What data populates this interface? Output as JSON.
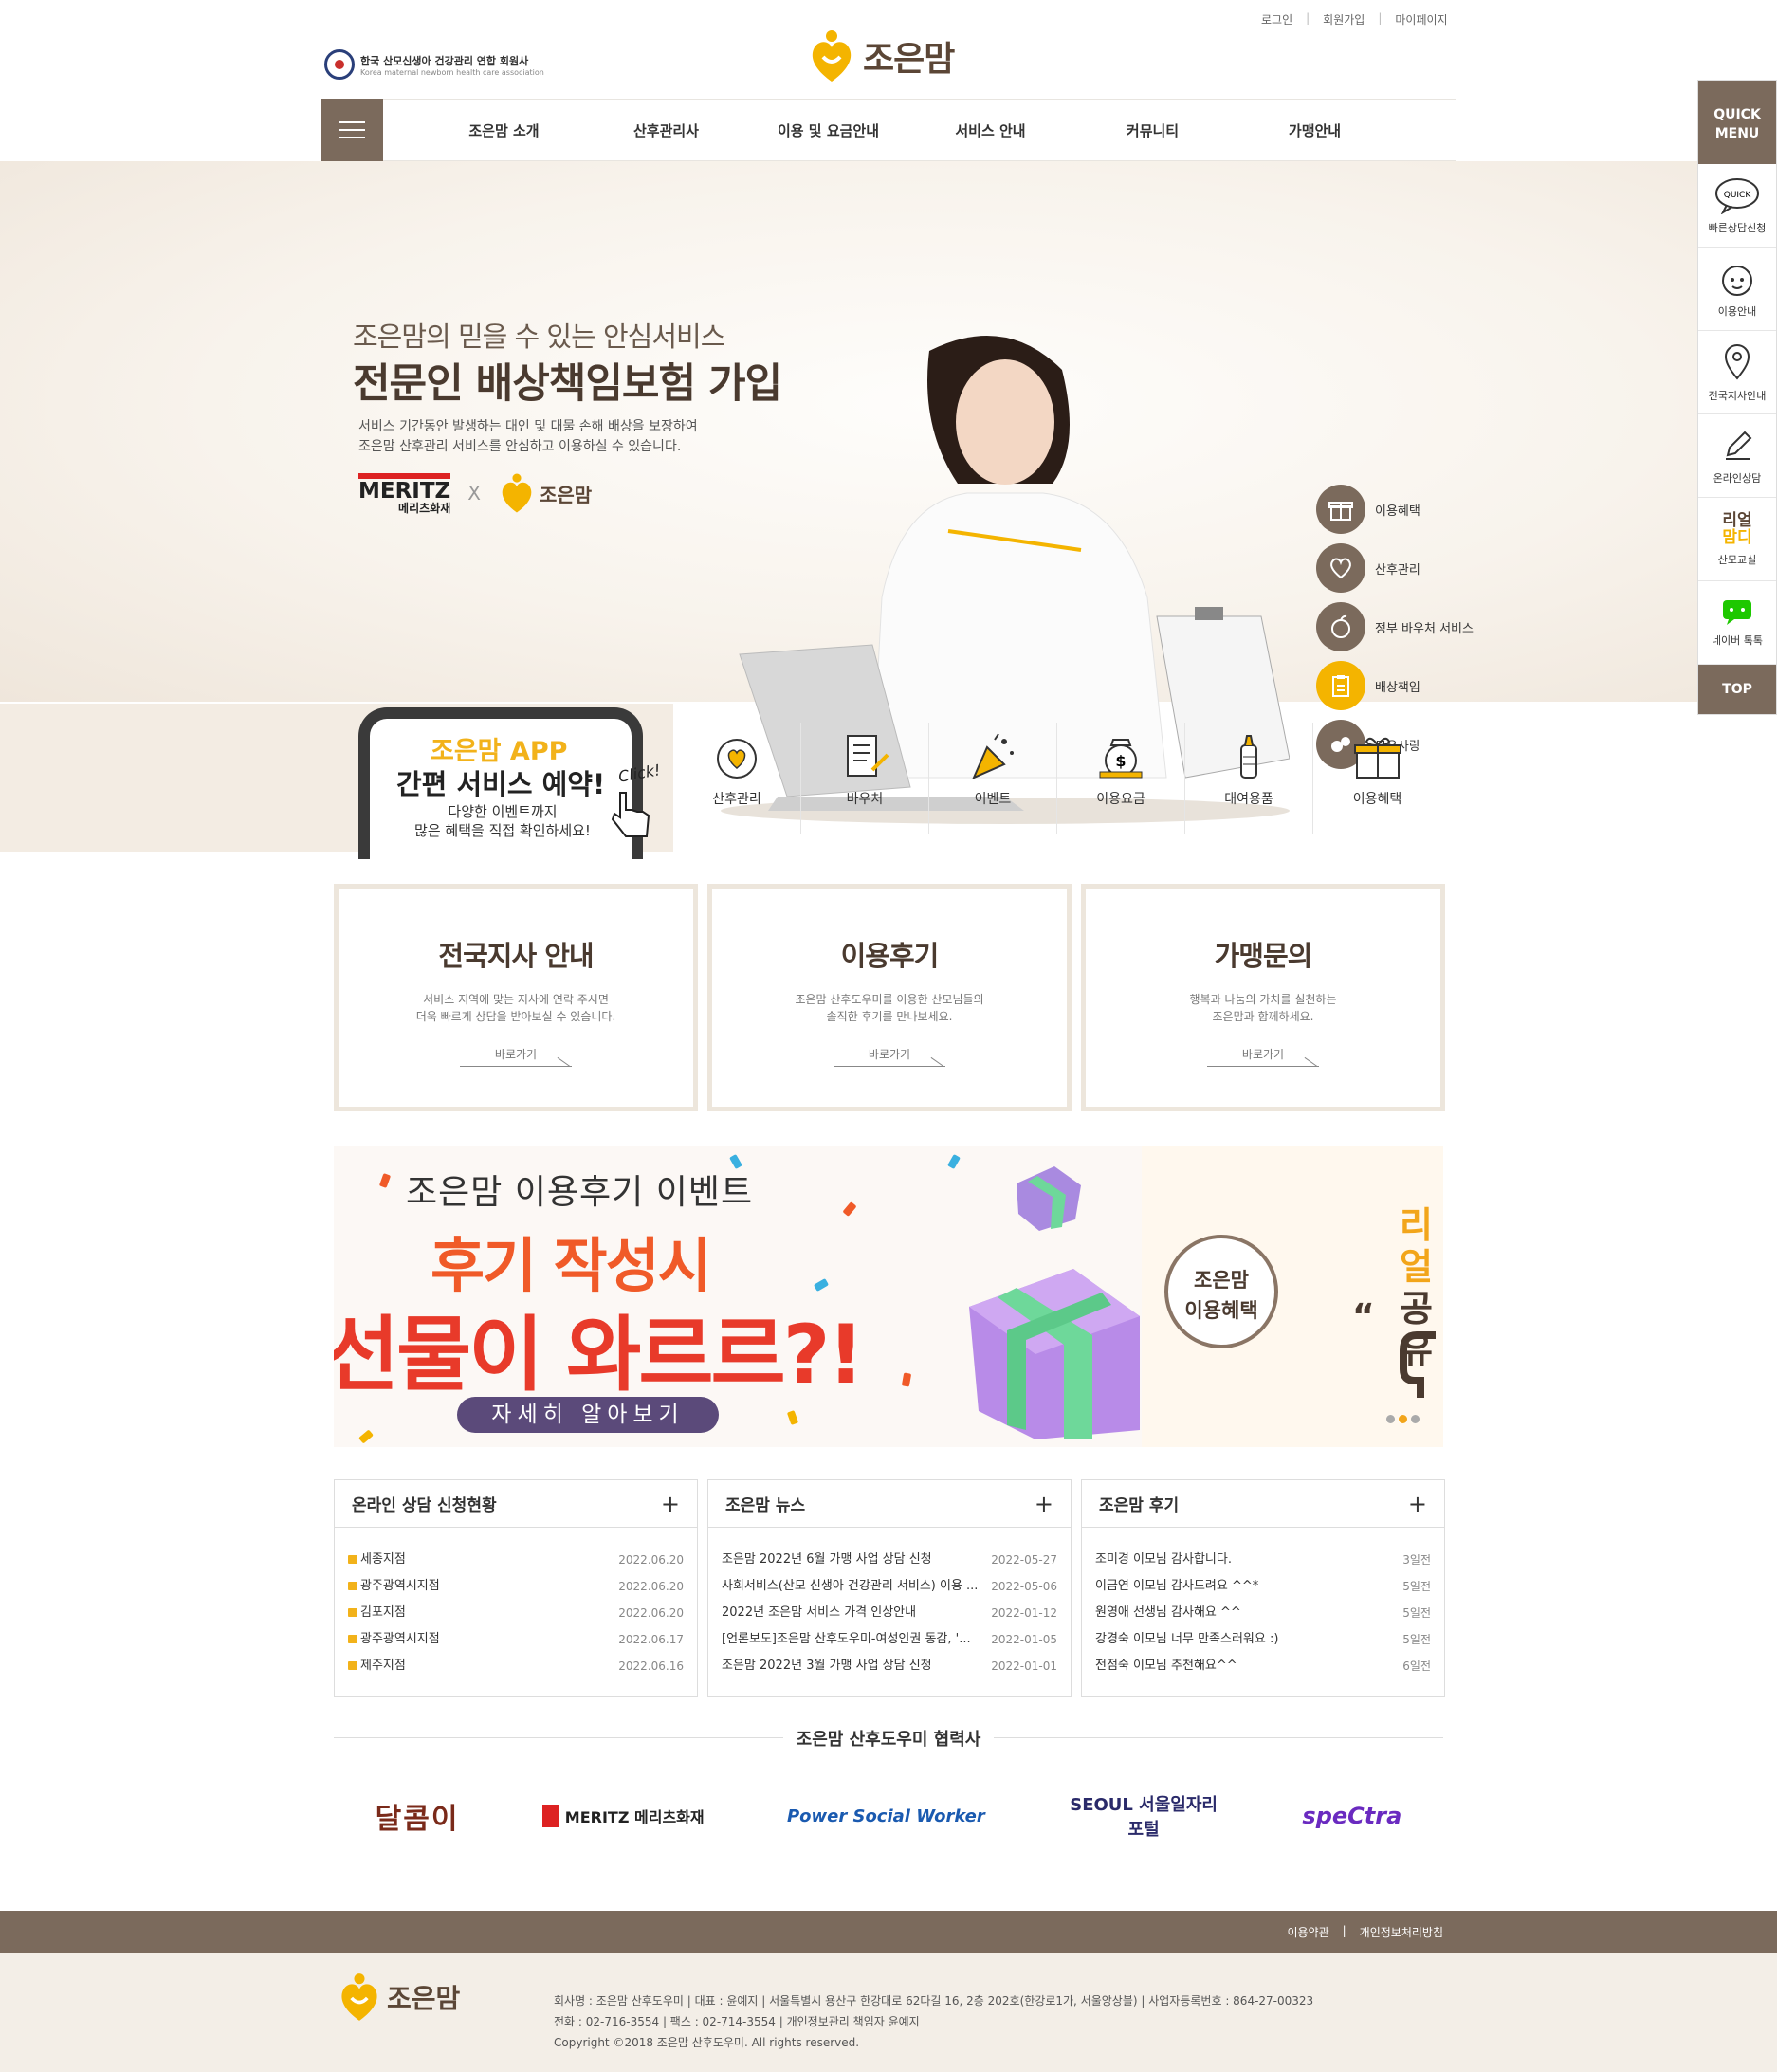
{
  "util_links": {
    "login": "로그인",
    "signup": "회원가입",
    "mypage": "마이페이지"
  },
  "association": {
    "name": "한국 산모신생아 건강관리 연합 회원사",
    "sub": "Korea maternal newborn health care association"
  },
  "brand": {
    "name": "조은맘"
  },
  "nav": [
    "조은맘 소개",
    "산후관리사",
    "이용 및 요금안내",
    "서비스 안내",
    "커뮤니티",
    "가맹안내"
  ],
  "hero": {
    "sub": "조은맘의 믿을 수 있는 안심서비스",
    "main": "전문인 배상책임보험 가입",
    "desc_1": "서비스 기간동안 발생하는 대인 및 대물 손해 배상을 보장하여",
    "desc_2": "조은맘 산후관리 서비스를 안심하고 이용하실 수 있습니다.",
    "partner_en": "MERITZ",
    "partner_kr": "메리츠화재",
    "x": "X",
    "brand": "조은맘",
    "side_menu": [
      "이용혜택",
      "산후관리",
      "정부 바우처 서비스",
      "배상책임",
      "모유사랑"
    ]
  },
  "quick": {
    "title_1": "QUICK",
    "title_2": "MENU",
    "items": [
      "빠른상담신청",
      "이용안내",
      "전국지사안내",
      "온라인상담",
      "산모교실",
      "네이버 톡톡"
    ],
    "quick_badge": "QUICK",
    "realmom_1": "리얼",
    "realmom_2": "맘디",
    "top": "TOP"
  },
  "app": {
    "t1": "조은맘 APP",
    "t2": "간편 서비스 예약!",
    "t3_1": "다양한 이벤트까지",
    "t3_2": "많은 혜택을 직접 확인하세요!",
    "click": "Click!"
  },
  "services": [
    "산후관리",
    "바우처",
    "이벤트",
    "이용요금",
    "대여용품",
    "이용혜택"
  ],
  "boxes": [
    {
      "title": "전국지사 안내",
      "d1": "서비스 지역에 맞는 지사에 연락 주시면",
      "d2": "더욱 빠르게 상담을 받아보실 수 있습니다.",
      "go": "바로가기"
    },
    {
      "title": "이용후기",
      "d1": "조은맘 산후도우미를 이용한 산모님들의",
      "d2": "솔직한 후기를 만나보세요.",
      "go": "바로가기"
    },
    {
      "title": "가맹문의",
      "d1": "행복과 나눔의 가치를 실천하는",
      "d2": "조은맘과 함께하세요.",
      "go": "바로가기"
    }
  ],
  "banner": {
    "b1": "조은맘 이용후기 이벤트",
    "b2": "후기 작성시",
    "b3": "선물이 와르르?!",
    "btn": "자세히 알아보기"
  },
  "benefit": {
    "c1": "조은맘",
    "c2": "이용혜택",
    "quote": "“",
    "r1": "리얼",
    "r2": "공유"
  },
  "boards": [
    {
      "title": "온라인 상담 신청현황",
      "plus": "+",
      "rows": [
        {
          "t": "세종지점",
          "d": "2022.06.20"
        },
        {
          "t": "광주광역시지점",
          "d": "2022.06.20"
        },
        {
          "t": "김포지점",
          "d": "2022.06.20"
        },
        {
          "t": "광주광역시지점",
          "d": "2022.06.17"
        },
        {
          "t": "제주지점",
          "d": "2022.06.16"
        }
      ]
    },
    {
      "title": "조은맘 뉴스",
      "plus": "+",
      "rows": [
        {
          "t": "조은맘 2022년 6월 가맹 사업 상담 신청",
          "d": "2022-05-27"
        },
        {
          "t": "사회서비스(산모 신생아 건강관리 서비스) 이용 ...",
          "d": "2022-05-06"
        },
        {
          "t": "2022년 조은맘 서비스 가격 인상안내",
          "d": "2022-01-12"
        },
        {
          "t": "[언론보도]조은맘 산후도우미-여성인권 동감, '...",
          "d": "2022-01-05"
        },
        {
          "t": "조은맘 2022년 3월 가맹 사업 상담 신청",
          "d": "2022-01-01"
        }
      ]
    },
    {
      "title": "조은맘 후기",
      "plus": "+",
      "rows": [
        {
          "t": "조미경 이모님 감사합니다.",
          "d": "3일전"
        },
        {
          "t": "이금연 이모님 감사드려요 ^^*",
          "d": "5일전"
        },
        {
          "t": "원영애 선생님 감사해요 ^^",
          "d": "5일전"
        },
        {
          "t": "강경숙 이모님 너무 만족스러워요 :)",
          "d": "5일전"
        },
        {
          "t": "전점숙 이모님 추천해요^^",
          "d": "6일전"
        }
      ]
    }
  ],
  "partners_title": "조은맘 산후도우미 협력사",
  "partners": [
    "달콤이",
    "MERITZ 메리츠화재",
    "Power Social Worker",
    "SEOUL 서울일자리포털",
    "speCtra"
  ],
  "footer": {
    "terms": "이용약관",
    "privacy": "개인정보처리방침",
    "line1": "회사명 : 조은맘 산후도우미 | 대표 : 윤예지 | 서울특별시 용산구 한강대로 62다길 16, 2층 202호(한강로1가, 서울앙상블) | 사업자등록번호 : 864-27-00323",
    "line2": "전화 : 02-716-3554 | 팩스 : 02-714-3554 | 개인정보관리 책임자 윤예지",
    "line3": "Copyright ©2018 조은맘 산후도우미. All rights reserved."
  },
  "colors": {
    "brown": "#7b6a5c",
    "gold": "#f4b400",
    "dark_brown": "#4a3a2f",
    "red": "#e83a2a"
  }
}
